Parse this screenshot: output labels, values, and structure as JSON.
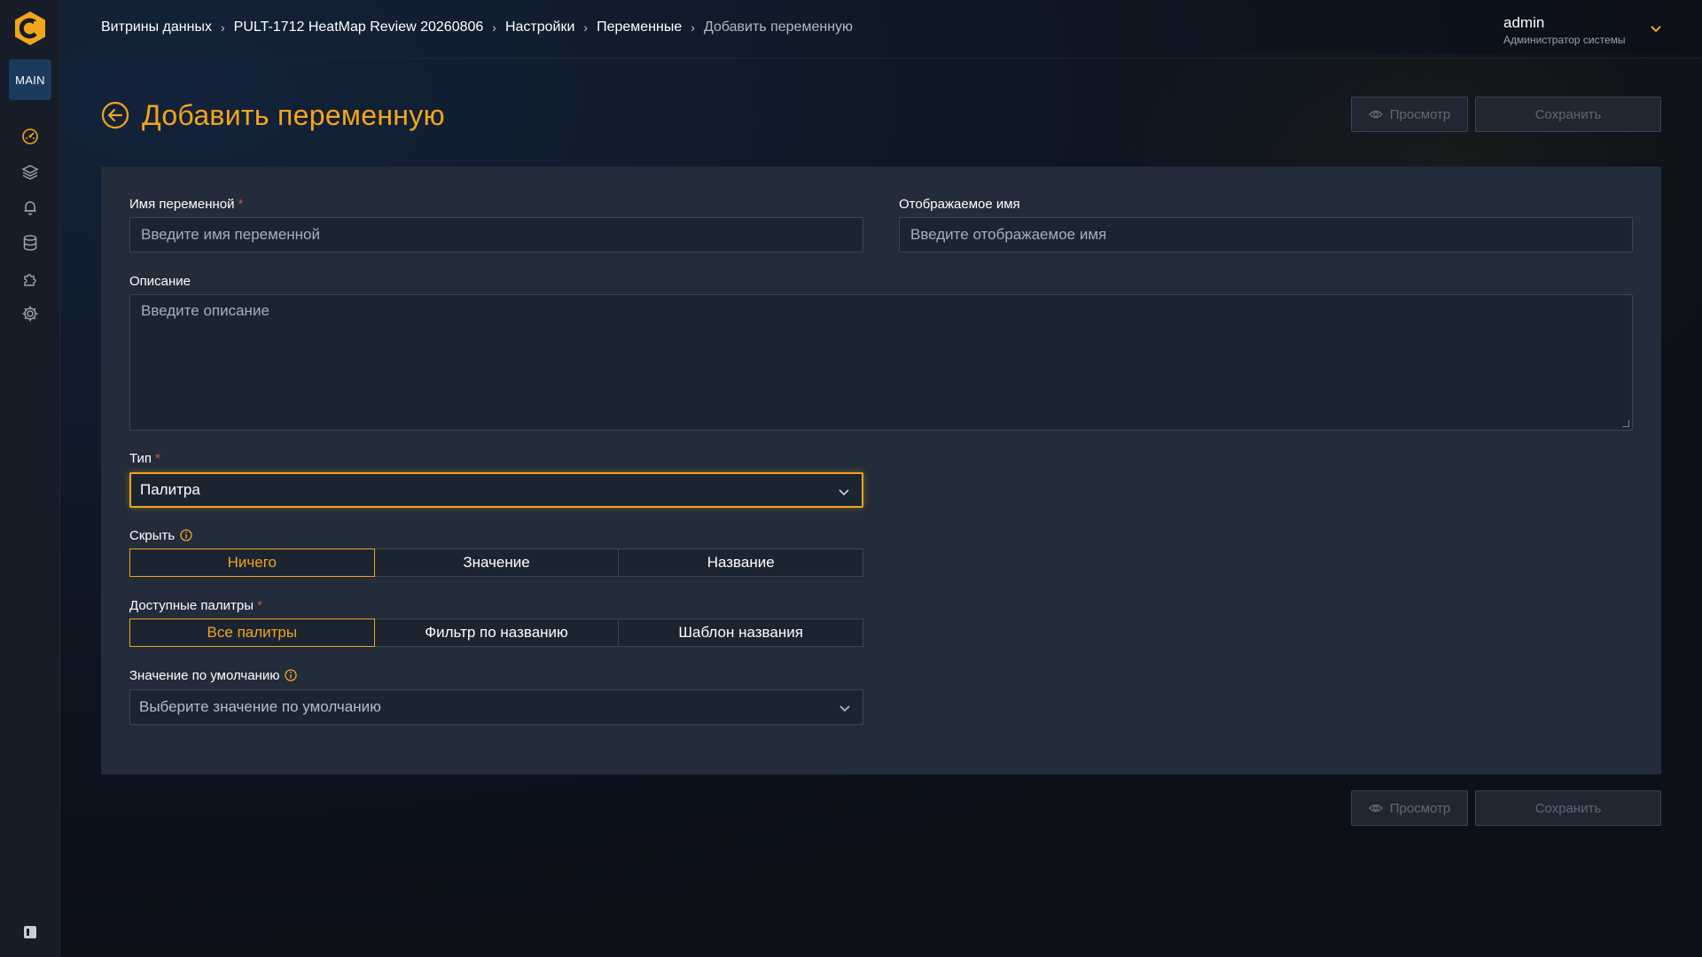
{
  "sidebar": {
    "badge": "MAIN",
    "icons": [
      "dashboard-icon",
      "layers-icon",
      "bell-icon",
      "database-icon",
      "plugin-icon",
      "gear-icon"
    ]
  },
  "breadcrumb": {
    "items": [
      "Витрины данных",
      "PULT-1712 HeatMap Review 20260806",
      "Настройки",
      "Переменные"
    ],
    "current": "Добавить переменную"
  },
  "user": {
    "name": "admin",
    "role": "Администратор системы"
  },
  "page": {
    "title": "Добавить переменную"
  },
  "actions": {
    "preview": "Просмотр",
    "save": "Сохранить"
  },
  "form": {
    "name": {
      "label": "Имя переменной",
      "required": "*",
      "placeholder": "Введите имя переменной"
    },
    "display_name": {
      "label": "Отображаемое имя",
      "placeholder": "Введите отображаемое имя"
    },
    "description": {
      "label": "Описание",
      "placeholder": "Введите описание"
    },
    "type": {
      "label": "Тип",
      "required": "*",
      "value": "Палитра"
    },
    "hide": {
      "label": "Скрыть",
      "options": [
        "Ничего",
        "Значение",
        "Название"
      ],
      "selected": 0
    },
    "palettes": {
      "label": "Доступные палитры",
      "required": "*",
      "options": [
        "Все палитры",
        "Фильтр по названию",
        "Шаблон названия"
      ],
      "selected": 0
    },
    "default": {
      "label": "Значение по умолчанию",
      "placeholder": "Выберите значение по умолчанию"
    }
  },
  "colors": {
    "accent": "#f3a51d",
    "required": "#e04a3c",
    "card": "#222c3a",
    "sidebar": "#161d28"
  }
}
